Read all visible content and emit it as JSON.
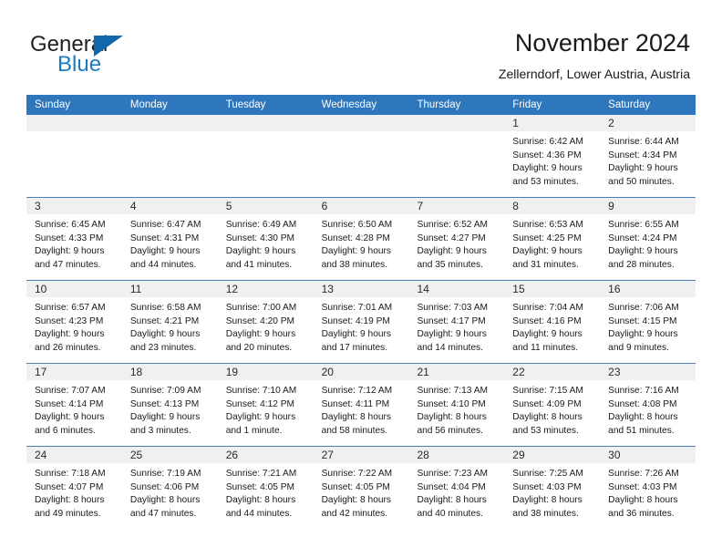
{
  "logo": {
    "word_top": "General",
    "word_bottom": "Blue",
    "triangle_color": "#1268ad",
    "blue_text_color": "#1b7bc1"
  },
  "header": {
    "title": "November 2024",
    "subtitle": "Zellerndorf, Lower Austria, Austria"
  },
  "colors": {
    "header_blue": "#2f77bc",
    "row_divider": "#4a7ebb",
    "day_band": "#f0f0f0"
  },
  "calendar": {
    "day_names": [
      "Sunday",
      "Monday",
      "Tuesday",
      "Wednesday",
      "Thursday",
      "Friday",
      "Saturday"
    ],
    "weeks": [
      [
        {
          "date": "",
          "empty": true
        },
        {
          "date": "",
          "empty": true
        },
        {
          "date": "",
          "empty": true
        },
        {
          "date": "",
          "empty": true
        },
        {
          "date": "",
          "empty": true
        },
        {
          "date": "1",
          "sunrise": "Sunrise: 6:42 AM",
          "sunset": "Sunset: 4:36 PM",
          "daylight1": "Daylight: 9 hours",
          "daylight2": "and 53 minutes."
        },
        {
          "date": "2",
          "sunrise": "Sunrise: 6:44 AM",
          "sunset": "Sunset: 4:34 PM",
          "daylight1": "Daylight: 9 hours",
          "daylight2": "and 50 minutes."
        }
      ],
      [
        {
          "date": "3",
          "sunrise": "Sunrise: 6:45 AM",
          "sunset": "Sunset: 4:33 PM",
          "daylight1": "Daylight: 9 hours",
          "daylight2": "and 47 minutes."
        },
        {
          "date": "4",
          "sunrise": "Sunrise: 6:47 AM",
          "sunset": "Sunset: 4:31 PM",
          "daylight1": "Daylight: 9 hours",
          "daylight2": "and 44 minutes."
        },
        {
          "date": "5",
          "sunrise": "Sunrise: 6:49 AM",
          "sunset": "Sunset: 4:30 PM",
          "daylight1": "Daylight: 9 hours",
          "daylight2": "and 41 minutes."
        },
        {
          "date": "6",
          "sunrise": "Sunrise: 6:50 AM",
          "sunset": "Sunset: 4:28 PM",
          "daylight1": "Daylight: 9 hours",
          "daylight2": "and 38 minutes."
        },
        {
          "date": "7",
          "sunrise": "Sunrise: 6:52 AM",
          "sunset": "Sunset: 4:27 PM",
          "daylight1": "Daylight: 9 hours",
          "daylight2": "and 35 minutes."
        },
        {
          "date": "8",
          "sunrise": "Sunrise: 6:53 AM",
          "sunset": "Sunset: 4:25 PM",
          "daylight1": "Daylight: 9 hours",
          "daylight2": "and 31 minutes."
        },
        {
          "date": "9",
          "sunrise": "Sunrise: 6:55 AM",
          "sunset": "Sunset: 4:24 PM",
          "daylight1": "Daylight: 9 hours",
          "daylight2": "and 28 minutes."
        }
      ],
      [
        {
          "date": "10",
          "sunrise": "Sunrise: 6:57 AM",
          "sunset": "Sunset: 4:23 PM",
          "daylight1": "Daylight: 9 hours",
          "daylight2": "and 26 minutes."
        },
        {
          "date": "11",
          "sunrise": "Sunrise: 6:58 AM",
          "sunset": "Sunset: 4:21 PM",
          "daylight1": "Daylight: 9 hours",
          "daylight2": "and 23 minutes."
        },
        {
          "date": "12",
          "sunrise": "Sunrise: 7:00 AM",
          "sunset": "Sunset: 4:20 PM",
          "daylight1": "Daylight: 9 hours",
          "daylight2": "and 20 minutes."
        },
        {
          "date": "13",
          "sunrise": "Sunrise: 7:01 AM",
          "sunset": "Sunset: 4:19 PM",
          "daylight1": "Daylight: 9 hours",
          "daylight2": "and 17 minutes."
        },
        {
          "date": "14",
          "sunrise": "Sunrise: 7:03 AM",
          "sunset": "Sunset: 4:17 PM",
          "daylight1": "Daylight: 9 hours",
          "daylight2": "and 14 minutes."
        },
        {
          "date": "15",
          "sunrise": "Sunrise: 7:04 AM",
          "sunset": "Sunset: 4:16 PM",
          "daylight1": "Daylight: 9 hours",
          "daylight2": "and 11 minutes."
        },
        {
          "date": "16",
          "sunrise": "Sunrise: 7:06 AM",
          "sunset": "Sunset: 4:15 PM",
          "daylight1": "Daylight: 9 hours",
          "daylight2": "and 9 minutes."
        }
      ],
      [
        {
          "date": "17",
          "sunrise": "Sunrise: 7:07 AM",
          "sunset": "Sunset: 4:14 PM",
          "daylight1": "Daylight: 9 hours",
          "daylight2": "and 6 minutes."
        },
        {
          "date": "18",
          "sunrise": "Sunrise: 7:09 AM",
          "sunset": "Sunset: 4:13 PM",
          "daylight1": "Daylight: 9 hours",
          "daylight2": "and 3 minutes."
        },
        {
          "date": "19",
          "sunrise": "Sunrise: 7:10 AM",
          "sunset": "Sunset: 4:12 PM",
          "daylight1": "Daylight: 9 hours",
          "daylight2": "and 1 minute."
        },
        {
          "date": "20",
          "sunrise": "Sunrise: 7:12 AM",
          "sunset": "Sunset: 4:11 PM",
          "daylight1": "Daylight: 8 hours",
          "daylight2": "and 58 minutes."
        },
        {
          "date": "21",
          "sunrise": "Sunrise: 7:13 AM",
          "sunset": "Sunset: 4:10 PM",
          "daylight1": "Daylight: 8 hours",
          "daylight2": "and 56 minutes."
        },
        {
          "date": "22",
          "sunrise": "Sunrise: 7:15 AM",
          "sunset": "Sunset: 4:09 PM",
          "daylight1": "Daylight: 8 hours",
          "daylight2": "and 53 minutes."
        },
        {
          "date": "23",
          "sunrise": "Sunrise: 7:16 AM",
          "sunset": "Sunset: 4:08 PM",
          "daylight1": "Daylight: 8 hours",
          "daylight2": "and 51 minutes."
        }
      ],
      [
        {
          "date": "24",
          "sunrise": "Sunrise: 7:18 AM",
          "sunset": "Sunset: 4:07 PM",
          "daylight1": "Daylight: 8 hours",
          "daylight2": "and 49 minutes."
        },
        {
          "date": "25",
          "sunrise": "Sunrise: 7:19 AM",
          "sunset": "Sunset: 4:06 PM",
          "daylight1": "Daylight: 8 hours",
          "daylight2": "and 47 minutes."
        },
        {
          "date": "26",
          "sunrise": "Sunrise: 7:21 AM",
          "sunset": "Sunset: 4:05 PM",
          "daylight1": "Daylight: 8 hours",
          "daylight2": "and 44 minutes."
        },
        {
          "date": "27",
          "sunrise": "Sunrise: 7:22 AM",
          "sunset": "Sunset: 4:05 PM",
          "daylight1": "Daylight: 8 hours",
          "daylight2": "and 42 minutes."
        },
        {
          "date": "28",
          "sunrise": "Sunrise: 7:23 AM",
          "sunset": "Sunset: 4:04 PM",
          "daylight1": "Daylight: 8 hours",
          "daylight2": "and 40 minutes."
        },
        {
          "date": "29",
          "sunrise": "Sunrise: 7:25 AM",
          "sunset": "Sunset: 4:03 PM",
          "daylight1": "Daylight: 8 hours",
          "daylight2": "and 38 minutes."
        },
        {
          "date": "30",
          "sunrise": "Sunrise: 7:26 AM",
          "sunset": "Sunset: 4:03 PM",
          "daylight1": "Daylight: 8 hours",
          "daylight2": "and 36 minutes."
        }
      ]
    ]
  }
}
